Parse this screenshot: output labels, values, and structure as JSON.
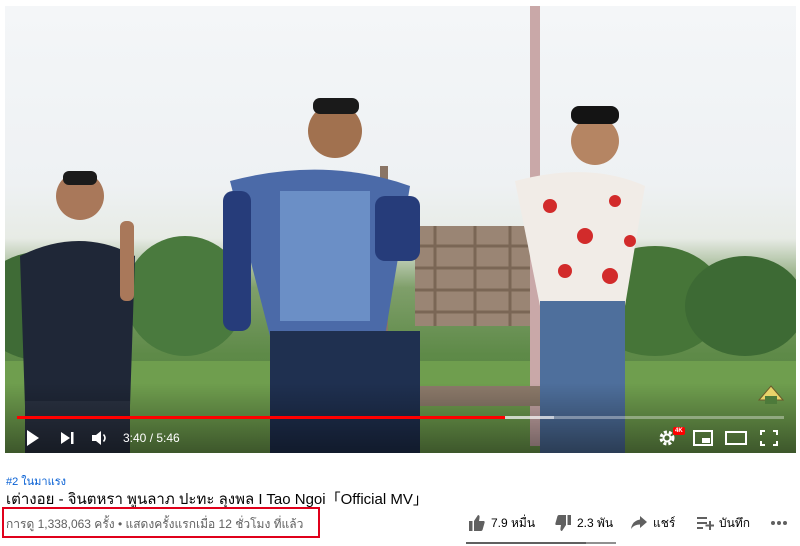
{
  "player": {
    "current_time": "3:40",
    "separator": " / ",
    "duration": "5:46",
    "played_fraction": 0.636,
    "buffered_fraction": 0.7,
    "quality_badge": "4K"
  },
  "video": {
    "trending": "#2 ในมาแรง",
    "title": "เต่างอย - จินตหรา พูนลาภ ปะทะ ลุงพล I Tao Ngoi「Official MV」",
    "meta": "การดู 1,338,063 ครั้ง • แสดงครั้งแรกเมื่อ 12 ชั่วโมง ที่แล้ว"
  },
  "actions": {
    "like_count": "7.9 หมื่น",
    "dislike_count": "2.3 พัน",
    "share_label": "แชร์",
    "save_label": "บันทึก",
    "like_ratio": 0.8
  },
  "colors": {
    "progress": "#ff0000",
    "highlight_box": "#e0001b",
    "link": "#065fd4"
  }
}
